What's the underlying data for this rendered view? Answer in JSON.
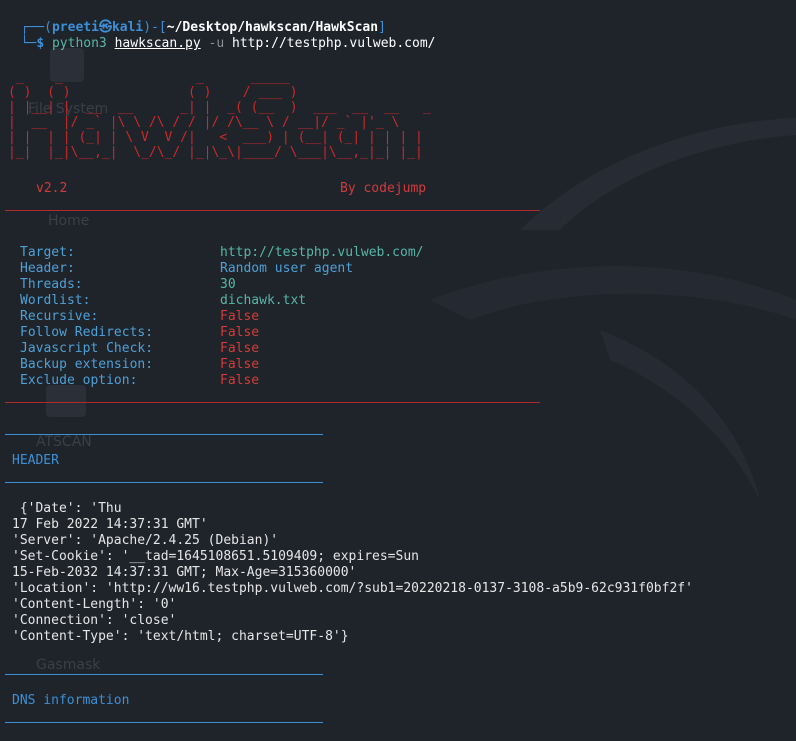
{
  "prompt": {
    "corner_top": "┌──(",
    "user": "preeti",
    "at_symbol": "㉿",
    "host": "kali",
    "sep": ")-[",
    "path": "~/Desktop/hawkscan/HawkScan",
    "close": "]",
    "corner_bottom": "└─",
    "dollar": "$",
    "command": "python3",
    "script": "hawkscan.py",
    "flag": "-u",
    "url": "http://testphp.vulweb.com/"
  },
  "banner": {
    "version": "v2.2",
    "author": "By codejump",
    "ascii": [
      " _    _                 _      _____                  ",
      "( )  ( )               ( )    / ___ )                 ",
      "| |__| |  __  __      _| |  _( (__  )  ___  __  __   _ ",
      "|  __  |/ _` |\\ \\ /\\ / / |/ /\\__ \\ / __|/ _` |'_ \\ ",
      "| |  | | (_| | \\ V  V /|   <  ___) | (__| (_| | | | |",
      "|_|  |_|\\__,_|  \\_/\\_/ |_|\\_\\|____/ \\___|\\__,_|_| |_|"
    ]
  },
  "config": [
    {
      "label": "Target:",
      "value": "http://testphp.vulweb.com/",
      "color": "#58b6a8"
    },
    {
      "label": "Header:",
      "value": "Random user agent",
      "color": "#4fa0d6"
    },
    {
      "label": "Threads:",
      "value": "30",
      "color": "#58b6a8"
    },
    {
      "label": "Wordlist:",
      "value": "dichawk.txt",
      "color": "#58b6a8"
    },
    {
      "label": "Recursive:",
      "value": "False",
      "color": "#d23b3b"
    },
    {
      "label": "Follow Redirects:",
      "value": "False",
      "color": "#d23b3b"
    },
    {
      "label": "Javascript Check:",
      "value": "False",
      "color": "#d23b3b"
    },
    {
      "label": "Backup extension:",
      "value": "False",
      "color": "#d23b3b"
    },
    {
      "label": "Exclude option:",
      "value": "False",
      "color": "#d23b3b"
    }
  ],
  "header_section": {
    "title": "HEADER",
    "lines": [
      " {'Date': 'Thu",
      "17 Feb 2022 14:37:31 GMT'",
      "'Server': 'Apache/2.4.25 (Debian)'",
      "'Set-Cookie': '__tad=1645108651.5109409; expires=Sun",
      "15-Feb-2032 14:37:31 GMT; Max-Age=315360000'",
      "'Location': 'http://ww16.testphp.vulweb.com/?sub1=20220218-0137-3108-a5b9-62c931f0bf2f'",
      "'Content-Length': '0'",
      "'Connection': 'close'",
      "'Content-Type': 'text/html; charset=UTF-8'}"
    ]
  },
  "dns_section": {
    "title": "DNS information"
  },
  "desktop_ghost": {
    "file_system": "File System",
    "home": "Home",
    "atscan": "ATSCAN",
    "gasmask": "Gasmask"
  },
  "colors": {
    "background": "#1f232a",
    "prompt_blue": "#3d8fd6",
    "banner_red": "#cc2a2a",
    "label_blue": "#4fa0d6",
    "value_teal": "#58b6a8",
    "false_red": "#d23b3b"
  }
}
